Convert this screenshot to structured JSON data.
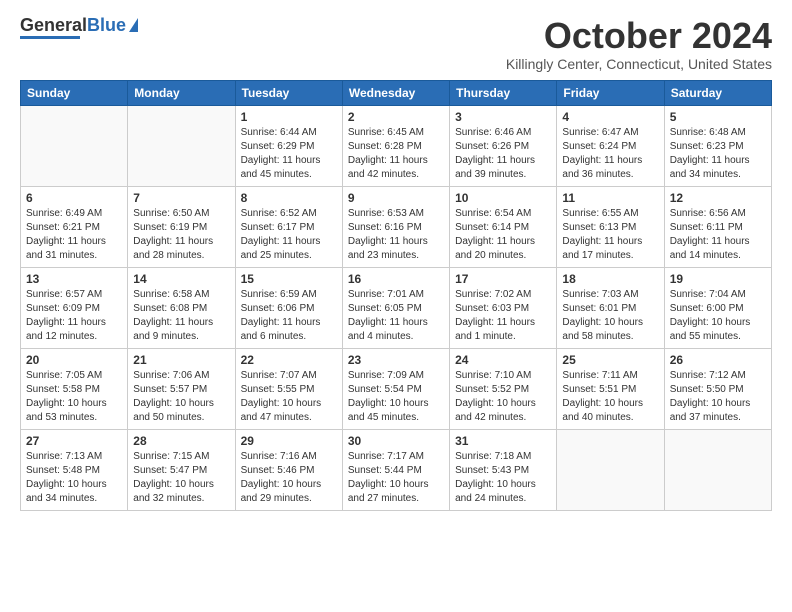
{
  "header": {
    "logo_general": "General",
    "logo_blue": "Blue",
    "month_title": "October 2024",
    "subtitle": "Killingly Center, Connecticut, United States"
  },
  "days_of_week": [
    "Sunday",
    "Monday",
    "Tuesday",
    "Wednesday",
    "Thursday",
    "Friday",
    "Saturday"
  ],
  "weeks": [
    [
      {
        "day": "",
        "empty": true
      },
      {
        "day": "",
        "empty": true
      },
      {
        "day": "1",
        "sunrise": "6:44 AM",
        "sunset": "6:29 PM",
        "daylight": "11 hours and 45 minutes."
      },
      {
        "day": "2",
        "sunrise": "6:45 AM",
        "sunset": "6:28 PM",
        "daylight": "11 hours and 42 minutes."
      },
      {
        "day": "3",
        "sunrise": "6:46 AM",
        "sunset": "6:26 PM",
        "daylight": "11 hours and 39 minutes."
      },
      {
        "day": "4",
        "sunrise": "6:47 AM",
        "sunset": "6:24 PM",
        "daylight": "11 hours and 36 minutes."
      },
      {
        "day": "5",
        "sunrise": "6:48 AM",
        "sunset": "6:23 PM",
        "daylight": "11 hours and 34 minutes."
      }
    ],
    [
      {
        "day": "6",
        "sunrise": "6:49 AM",
        "sunset": "6:21 PM",
        "daylight": "11 hours and 31 minutes."
      },
      {
        "day": "7",
        "sunrise": "6:50 AM",
        "sunset": "6:19 PM",
        "daylight": "11 hours and 28 minutes."
      },
      {
        "day": "8",
        "sunrise": "6:52 AM",
        "sunset": "6:17 PM",
        "daylight": "11 hours and 25 minutes."
      },
      {
        "day": "9",
        "sunrise": "6:53 AM",
        "sunset": "6:16 PM",
        "daylight": "11 hours and 23 minutes."
      },
      {
        "day": "10",
        "sunrise": "6:54 AM",
        "sunset": "6:14 PM",
        "daylight": "11 hours and 20 minutes."
      },
      {
        "day": "11",
        "sunrise": "6:55 AM",
        "sunset": "6:13 PM",
        "daylight": "11 hours and 17 minutes."
      },
      {
        "day": "12",
        "sunrise": "6:56 AM",
        "sunset": "6:11 PM",
        "daylight": "11 hours and 14 minutes."
      }
    ],
    [
      {
        "day": "13",
        "sunrise": "6:57 AM",
        "sunset": "6:09 PM",
        "daylight": "11 hours and 12 minutes."
      },
      {
        "day": "14",
        "sunrise": "6:58 AM",
        "sunset": "6:08 PM",
        "daylight": "11 hours and 9 minutes."
      },
      {
        "day": "15",
        "sunrise": "6:59 AM",
        "sunset": "6:06 PM",
        "daylight": "11 hours and 6 minutes."
      },
      {
        "day": "16",
        "sunrise": "7:01 AM",
        "sunset": "6:05 PM",
        "daylight": "11 hours and 4 minutes."
      },
      {
        "day": "17",
        "sunrise": "7:02 AM",
        "sunset": "6:03 PM",
        "daylight": "11 hours and 1 minute."
      },
      {
        "day": "18",
        "sunrise": "7:03 AM",
        "sunset": "6:01 PM",
        "daylight": "10 hours and 58 minutes."
      },
      {
        "day": "19",
        "sunrise": "7:04 AM",
        "sunset": "6:00 PM",
        "daylight": "10 hours and 55 minutes."
      }
    ],
    [
      {
        "day": "20",
        "sunrise": "7:05 AM",
        "sunset": "5:58 PM",
        "daylight": "10 hours and 53 minutes."
      },
      {
        "day": "21",
        "sunrise": "7:06 AM",
        "sunset": "5:57 PM",
        "daylight": "10 hours and 50 minutes."
      },
      {
        "day": "22",
        "sunrise": "7:07 AM",
        "sunset": "5:55 PM",
        "daylight": "10 hours and 47 minutes."
      },
      {
        "day": "23",
        "sunrise": "7:09 AM",
        "sunset": "5:54 PM",
        "daylight": "10 hours and 45 minutes."
      },
      {
        "day": "24",
        "sunrise": "7:10 AM",
        "sunset": "5:52 PM",
        "daylight": "10 hours and 42 minutes."
      },
      {
        "day": "25",
        "sunrise": "7:11 AM",
        "sunset": "5:51 PM",
        "daylight": "10 hours and 40 minutes."
      },
      {
        "day": "26",
        "sunrise": "7:12 AM",
        "sunset": "5:50 PM",
        "daylight": "10 hours and 37 minutes."
      }
    ],
    [
      {
        "day": "27",
        "sunrise": "7:13 AM",
        "sunset": "5:48 PM",
        "daylight": "10 hours and 34 minutes."
      },
      {
        "day": "28",
        "sunrise": "7:15 AM",
        "sunset": "5:47 PM",
        "daylight": "10 hours and 32 minutes."
      },
      {
        "day": "29",
        "sunrise": "7:16 AM",
        "sunset": "5:46 PM",
        "daylight": "10 hours and 29 minutes."
      },
      {
        "day": "30",
        "sunrise": "7:17 AM",
        "sunset": "5:44 PM",
        "daylight": "10 hours and 27 minutes."
      },
      {
        "day": "31",
        "sunrise": "7:18 AM",
        "sunset": "5:43 PM",
        "daylight": "10 hours and 24 minutes."
      },
      {
        "day": "",
        "empty": true
      },
      {
        "day": "",
        "empty": true
      }
    ]
  ]
}
